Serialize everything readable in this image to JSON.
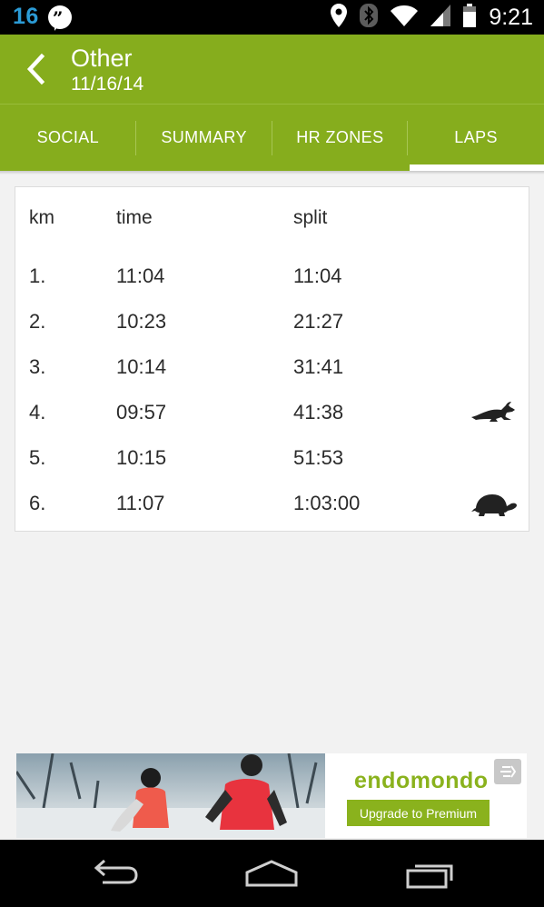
{
  "status_bar": {
    "notification_count": "16",
    "hangouts_glyph": "”",
    "time": "9:21",
    "icons": [
      "location-icon",
      "bluetooth-icon",
      "wifi-icon",
      "signal-icon",
      "battery-icon"
    ]
  },
  "app_bar": {
    "title": "Other",
    "subtitle": "11/16/14"
  },
  "tabs": [
    {
      "label": "SOCIAL",
      "active": false
    },
    {
      "label": "SUMMARY",
      "active": false
    },
    {
      "label": "HR ZONES",
      "active": false
    },
    {
      "label": "LAPS",
      "active": true
    }
  ],
  "laps": {
    "headers": {
      "km": "km",
      "time": "time",
      "split": "split"
    },
    "rows": [
      {
        "km": "1.",
        "time": "11:04",
        "split": "11:04",
        "marker": ""
      },
      {
        "km": "2.",
        "time": "10:23",
        "split": "21:27",
        "marker": ""
      },
      {
        "km": "3.",
        "time": "10:14",
        "split": "31:41",
        "marker": ""
      },
      {
        "km": "4.",
        "time": "09:57",
        "split": "41:38",
        "marker": "hare-icon"
      },
      {
        "km": "5.",
        "time": "10:15",
        "split": "51:53",
        "marker": ""
      },
      {
        "km": "6.",
        "time": "11:07",
        "split": "1:03:00",
        "marker": "turtle-icon"
      }
    ]
  },
  "ad": {
    "brand": "endomondo",
    "cta_label": "Upgrade to Premium"
  },
  "colors": {
    "app_green": "#86ad1d",
    "brand_green": "#8ab21d",
    "notification_blue": "#2b9bd6"
  },
  "nav_bar": {
    "buttons": [
      "back-icon",
      "home-icon",
      "recent-apps-icon"
    ]
  }
}
